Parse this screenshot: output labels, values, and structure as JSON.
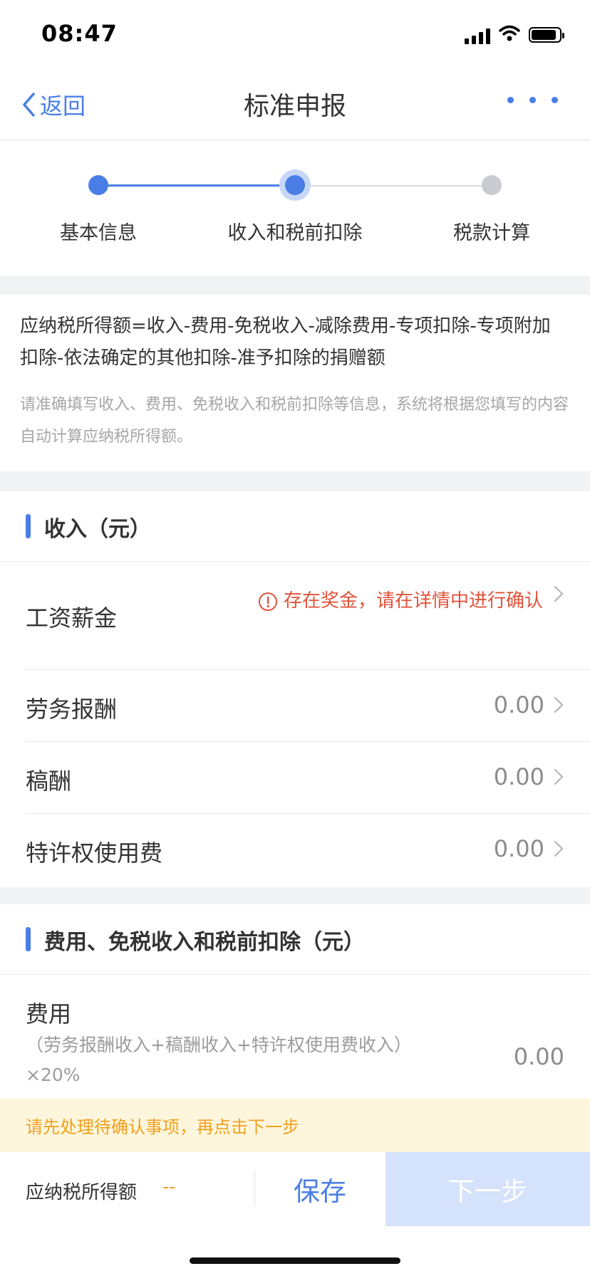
{
  "status_bar": {
    "time": "08:47"
  },
  "nav": {
    "back_label": "返回",
    "title": "标准申报"
  },
  "stepper": {
    "steps": [
      {
        "label": "基本信息",
        "state": "done"
      },
      {
        "label": "收入和税前扣除",
        "state": "current"
      },
      {
        "label": "税款计算",
        "state": "pending"
      }
    ],
    "accent": "#4a7ee6",
    "pending_color": "#c9cbd0"
  },
  "info": {
    "formula": "应纳税所得额=收入-费用-免税收入-减除费用-专项扣除-专项附加扣除-依法确定的其他扣除-准予扣除的捐赠额",
    "hint": "请准确填写收入、费用、免税收入和税前扣除等信息，系统将根据您填写的内容自动计算应纳税所得额。"
  },
  "income": {
    "title": "收入（元）",
    "rows": [
      {
        "label": "工资薪金",
        "warning": "存在奖金，请在详情中进行确认"
      },
      {
        "label": "劳务报酬",
        "value": "0.00"
      },
      {
        "label": "稿酬",
        "value": "0.00"
      },
      {
        "label": "特许权使用费",
        "value": "0.00"
      }
    ]
  },
  "deductions": {
    "title": "费用、免税收入和税前扣除（元）",
    "fee": {
      "label": "费用",
      "formula": "（劳务报酬收入+稿酬收入+特许权使用费收入）×20%",
      "value": "0.00"
    }
  },
  "notice": {
    "text": "请先处理待确认事项，再点击下一步"
  },
  "bottom": {
    "taxable_label": "应纳税所得额",
    "taxable_value": "--",
    "save_label": "保存",
    "next_label": "下一步"
  },
  "colors": {
    "accent": "#4a7ee6",
    "warning": "#e0533a",
    "notice": "#f0a020"
  }
}
